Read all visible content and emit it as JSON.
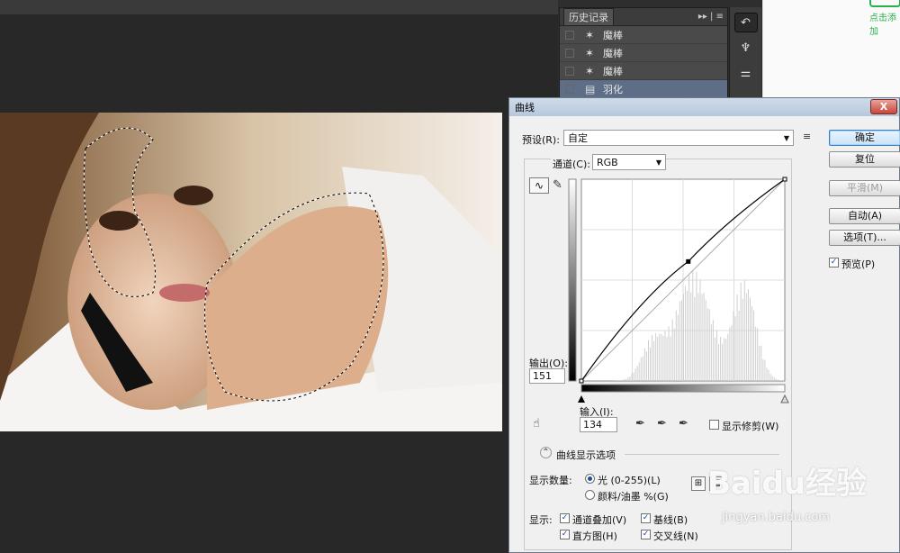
{
  "history_panel": {
    "tab_label": "历史记录",
    "menu_glyph": "▸▸ | ≡",
    "items": [
      {
        "label": "魔棒",
        "selected": false
      },
      {
        "label": "魔棒",
        "selected": false
      },
      {
        "label": "魔棒",
        "selected": false
      },
      {
        "label": "羽化",
        "selected": true
      }
    ]
  },
  "web_side": {
    "action_text": "点击添加"
  },
  "curves_dialog": {
    "title": "曲线",
    "close_label": "X",
    "preset_label": "预设(R):",
    "preset_value": "自定",
    "channel_label": "通道(C):",
    "channel_value": "RGB",
    "output_label": "输出(O):",
    "output_value": "151",
    "input_label": "输入(I):",
    "input_value": "134",
    "show_clipping_label": "显示修剪(W)",
    "show_clipping_checked": false,
    "display_options_label": "曲线显示选项",
    "show_amount_label": "显示数量:",
    "light_option": "光 (0-255)(L)",
    "pigment_option": "颜料/油墨 %(G)",
    "light_selected": true,
    "show_label": "显示:",
    "options": {
      "channel_overlay": "通道叠加(V)",
      "baseline": "基线(B)",
      "histogram": "直方图(H)",
      "intersection": "交叉线(N)"
    },
    "buttons": {
      "ok": "确定",
      "reset": "复位",
      "smooth": "平滑(M)",
      "auto": "自动(A)",
      "options": "选项(T)...",
      "preview": "预览(P)"
    },
    "curve_point": {
      "input": 134,
      "output": 151
    },
    "colors": {
      "accent": "#3b7fc4",
      "title_bar": "#c2d3e6"
    }
  },
  "watermark": {
    "brand": "Baidu经验",
    "url": "jingyan.baidu.com"
  }
}
